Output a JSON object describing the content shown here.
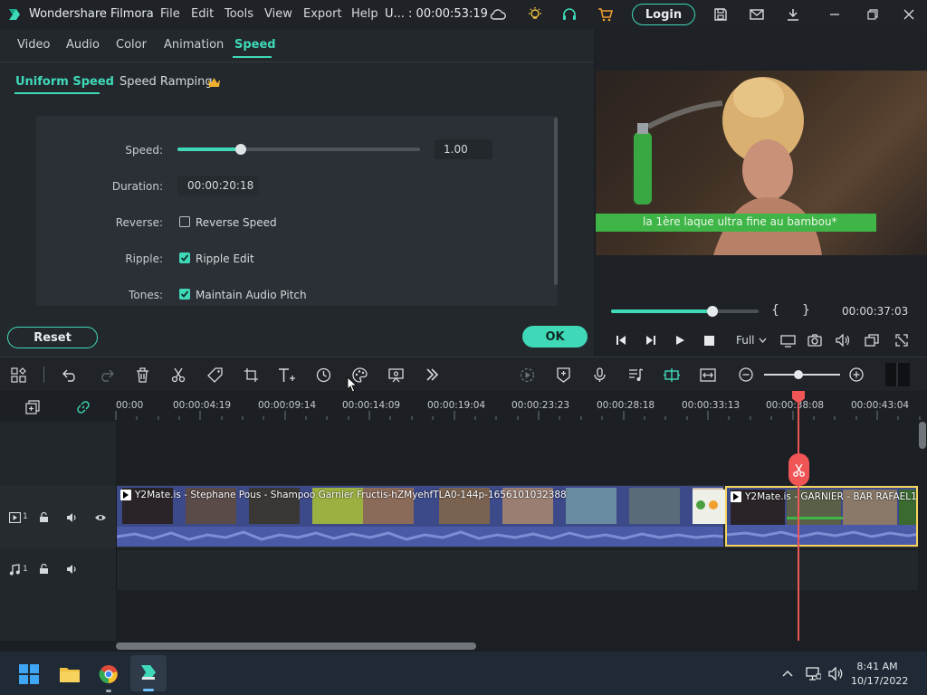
{
  "app": {
    "title": "Wondershare Filmora",
    "menu": [
      "File",
      "Edit",
      "Tools",
      "View",
      "Export",
      "Help"
    ],
    "project": "U... : 00:00:53:19",
    "login_label": "Login"
  },
  "panel": {
    "tabs": [
      "Video",
      "Audio",
      "Color",
      "Animation",
      "Speed"
    ],
    "active_tab": "Speed",
    "subtabs": [
      "Uniform Speed",
      "Speed Ramping"
    ],
    "active_subtab": "Uniform Speed",
    "speed_label": "Speed:",
    "speed_value": "1.00",
    "speed_slider_fraction": 0.26,
    "duration_label": "Duration:",
    "duration_value": "00:00:20:18",
    "reverse_label": "Reverse:",
    "reverse_text": "Reverse Speed",
    "reverse_checked": false,
    "ripple_label": "Ripple:",
    "ripple_text": "Ripple Edit",
    "ripple_checked": true,
    "tones_label": "Tones:",
    "tones_text": "Maintain Audio Pitch",
    "tones_checked": true,
    "reset_label": "Reset",
    "ok_label": "OK"
  },
  "preview": {
    "caption": "la 1ère laque ultra fine au bambou*",
    "timecode": "00:00:37:03",
    "progress_fraction": 0.69,
    "zoom": "Full",
    "brace_open": "{",
    "brace_close": "}"
  },
  "timeline": {
    "ticks": [
      "00:00",
      "00:00:04:19",
      "00:00:09:14",
      "00:00:14:09",
      "00:00:19:04",
      "00:00:23:23",
      "00:00:28:18",
      "00:00:33:13",
      "00:00:38:08",
      "00:00:43:04"
    ],
    "video_track_label": "1",
    "audio_track_label": "1",
    "clip1_name": "Y2Mate.is - Stephane Pous - Shampoo Garnier Fructis-hZMyehfTLA0-144p-1656101032388",
    "clip2_name": "Y2Mate.is - GARNIER - BAR RAFAEL1-"
  },
  "taskbar": {
    "time": "8:41 AM",
    "date": "10/17/2022"
  },
  "colors": {
    "accent": "#3fd9b8",
    "playhead": "#ef5555",
    "clip": "#3d4a8a",
    "selected_clip_border": "#f4d35e"
  }
}
